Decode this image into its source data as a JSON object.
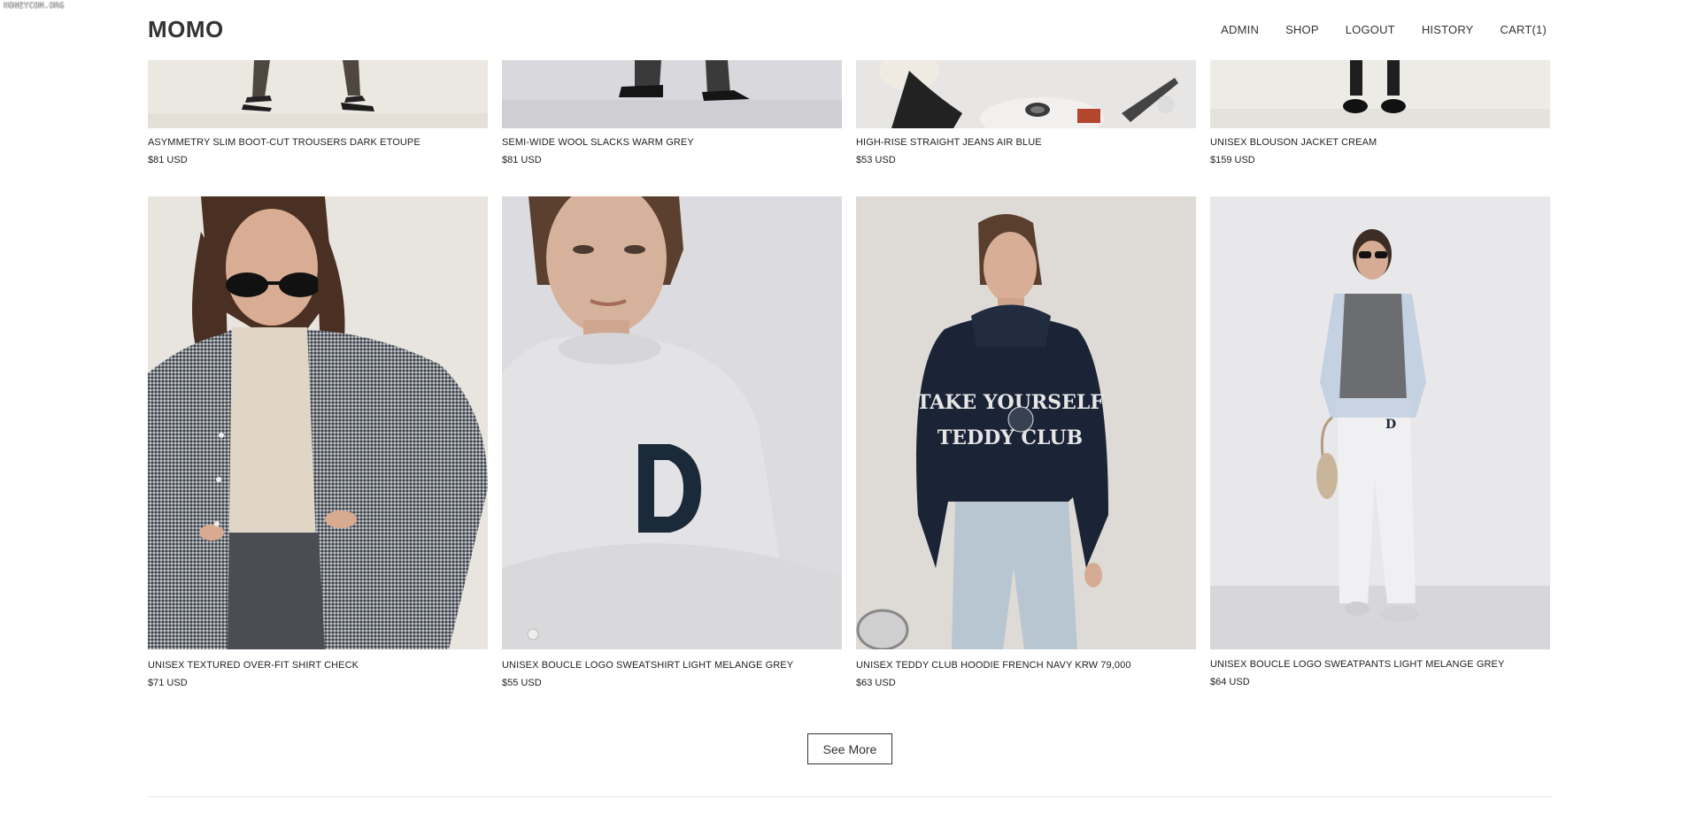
{
  "watermark": "HONEYCOM.ORG",
  "header": {
    "logo": "MOMO",
    "nav": [
      "ADMIN",
      "SHOP",
      "LOGOUT",
      "HISTORY",
      "CART(1)"
    ]
  },
  "products_top": [
    {
      "title": "ASYMMETRY SLIM BOOT-CUT TROUSERS DARK ETOUPE",
      "price": "$81 USD"
    },
    {
      "title": "SEMI-WIDE WOOL SLACKS WARM GREY",
      "price": "$81 USD"
    },
    {
      "title": "HIGH-RISE STRAIGHT JEANS AIR BLUE",
      "price": "$53 USD"
    },
    {
      "title": "UNISEX BLOUSON JACKET CREAM",
      "price": "$159 USD"
    }
  ],
  "products_bottom": [
    {
      "title": "UNISEX TEXTURED OVER-FIT SHIRT CHECK",
      "price": "$71 USD"
    },
    {
      "title": "UNISEX BOUCLE LOGO SWEATSHIRT LIGHT MELANGE GREY",
      "price": "$55 USD"
    },
    {
      "title": "UNISEX TEDDY CLUB HOODIE FRENCH NAVY KRW 79,000",
      "price": "$63 USD"
    },
    {
      "title": "UNISEX BOUCLE LOGO SWEATPANTS LIGHT MELANGE GREY",
      "price": "$64 USD"
    }
  ],
  "see_more_label": "See More",
  "colors": {
    "text": "#222222",
    "border": "#333333",
    "divider": "#e8e8e8"
  }
}
